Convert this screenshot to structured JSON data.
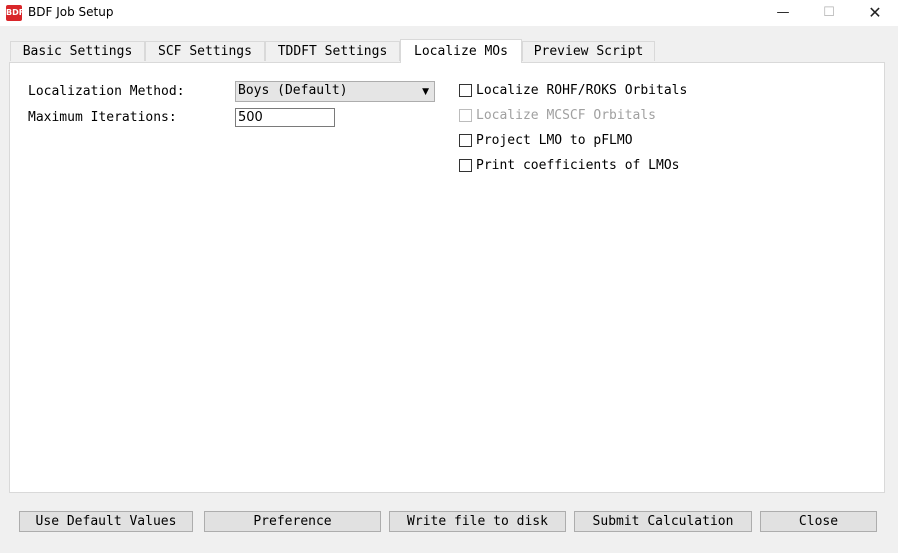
{
  "window": {
    "title": "BDF Job Setup",
    "icon_text": "BDF",
    "minimize_glyph": "—",
    "maximize_glyph": "☐",
    "close_glyph": "✕"
  },
  "tabs": [
    {
      "label": "Basic Settings",
      "active": false
    },
    {
      "label": "SCF Settings",
      "active": false
    },
    {
      "label": "TDDFT Settings",
      "active": false
    },
    {
      "label": "Localize MOs",
      "active": true
    },
    {
      "label": "Preview Script",
      "active": false
    }
  ],
  "form": {
    "method_label": "Localization Method:",
    "method_value": "Boys (Default)",
    "iterations_label": "Maximum Iterations:",
    "iterations_value": "500"
  },
  "options": [
    {
      "label": "Localize ROHF/ROKS Orbitals",
      "checked": false,
      "enabled": true
    },
    {
      "label": "Localize MCSCF Orbitals",
      "checked": false,
      "enabled": false
    },
    {
      "label": "Project LMO to pFLMO",
      "checked": false,
      "enabled": true
    },
    {
      "label": "Print coefficients of LMOs",
      "checked": false,
      "enabled": true
    }
  ],
  "buttons": {
    "defaults": "Use Default Values",
    "preference": "Preference",
    "write": "Write file to disk",
    "submit": "Submit Calculation",
    "close": "Close"
  }
}
